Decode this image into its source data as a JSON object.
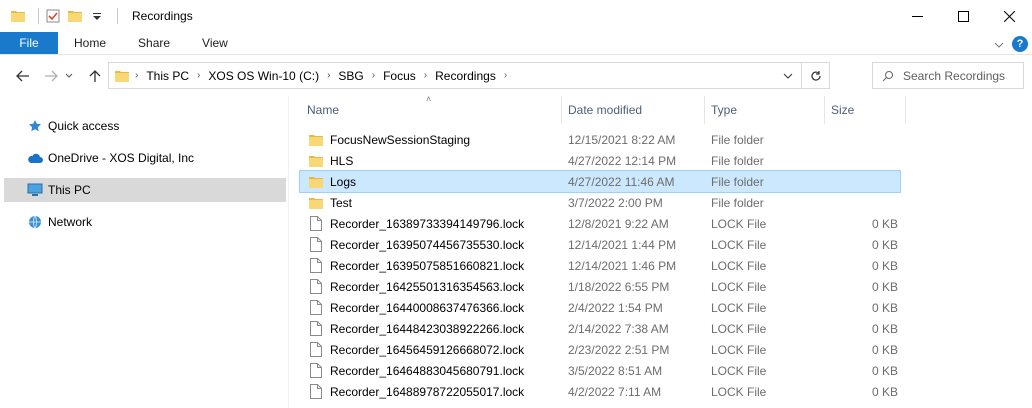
{
  "window": {
    "title": "Recordings",
    "minimize_symbol": "—",
    "maximize_symbol": "☐",
    "close_symbol": "✕"
  },
  "ribbon": {
    "tabs": [
      {
        "label": "File"
      },
      {
        "label": "Home"
      },
      {
        "label": "Share"
      },
      {
        "label": "View"
      }
    ],
    "help_label": "?"
  },
  "address": {
    "crumbs": [
      "This PC",
      "XOS OS Win-10 (C:)",
      "SBG",
      "Focus",
      "Recordings"
    ]
  },
  "search": {
    "placeholder": "Search Recordings"
  },
  "navpane": {
    "items": [
      {
        "label": "Quick access",
        "icon": "star-icon"
      },
      {
        "label": "OneDrive - XOS Digital, Inc",
        "icon": "cloud-icon"
      },
      {
        "label": "This PC",
        "icon": "computer-icon",
        "selected": true
      },
      {
        "label": "Network",
        "icon": "network-icon"
      }
    ]
  },
  "columns": {
    "name": "Name",
    "date": "Date modified",
    "type": "Type",
    "size": "Size"
  },
  "files": [
    {
      "name": "FocusNewSessionStaging",
      "date": "12/15/2021 8:22 AM",
      "type": "File folder",
      "size": "",
      "kind": "folder"
    },
    {
      "name": "HLS",
      "date": "4/27/2022 12:14 PM",
      "type": "File folder",
      "size": "",
      "kind": "folder"
    },
    {
      "name": "Logs",
      "date": "4/27/2022 11:46 AM",
      "type": "File folder",
      "size": "",
      "kind": "folder",
      "selected": true
    },
    {
      "name": "Test",
      "date": "3/7/2022 2:00 PM",
      "type": "File folder",
      "size": "",
      "kind": "folder"
    },
    {
      "name": "Recorder_16389733394149796.lock",
      "date": "12/8/2021 9:22 AM",
      "type": "LOCK File",
      "size": "0 KB",
      "kind": "file"
    },
    {
      "name": "Recorder_16395074456735530.lock",
      "date": "12/14/2021 1:44 PM",
      "type": "LOCK File",
      "size": "0 KB",
      "kind": "file"
    },
    {
      "name": "Recorder_16395075851660821.lock",
      "date": "12/14/2021 1:46 PM",
      "type": "LOCK File",
      "size": "0 KB",
      "kind": "file"
    },
    {
      "name": "Recorder_16425501316354563.lock",
      "date": "1/18/2022 6:55 PM",
      "type": "LOCK File",
      "size": "0 KB",
      "kind": "file"
    },
    {
      "name": "Recorder_16440008637476366.lock",
      "date": "2/4/2022 1:54 PM",
      "type": "LOCK File",
      "size": "0 KB",
      "kind": "file"
    },
    {
      "name": "Recorder_16448423038922266.lock",
      "date": "2/14/2022 7:38 AM",
      "type": "LOCK File",
      "size": "0 KB",
      "kind": "file"
    },
    {
      "name": "Recorder_16456459126668072.lock",
      "date": "2/23/2022 2:51 PM",
      "type": "LOCK File",
      "size": "0 KB",
      "kind": "file"
    },
    {
      "name": "Recorder_16464883045680791.lock",
      "date": "3/5/2022 8:51 AM",
      "type": "LOCK File",
      "size": "0 KB",
      "kind": "file"
    },
    {
      "name": "Recorder_16488978722055017.lock",
      "date": "4/2/2022 7:11 AM",
      "type": "LOCK File",
      "size": "0 KB",
      "kind": "file"
    }
  ],
  "colors": {
    "accent": "#1979ca",
    "selection": "#cce8ff",
    "folder": "#f8d775",
    "header_text": "#4c607a"
  }
}
